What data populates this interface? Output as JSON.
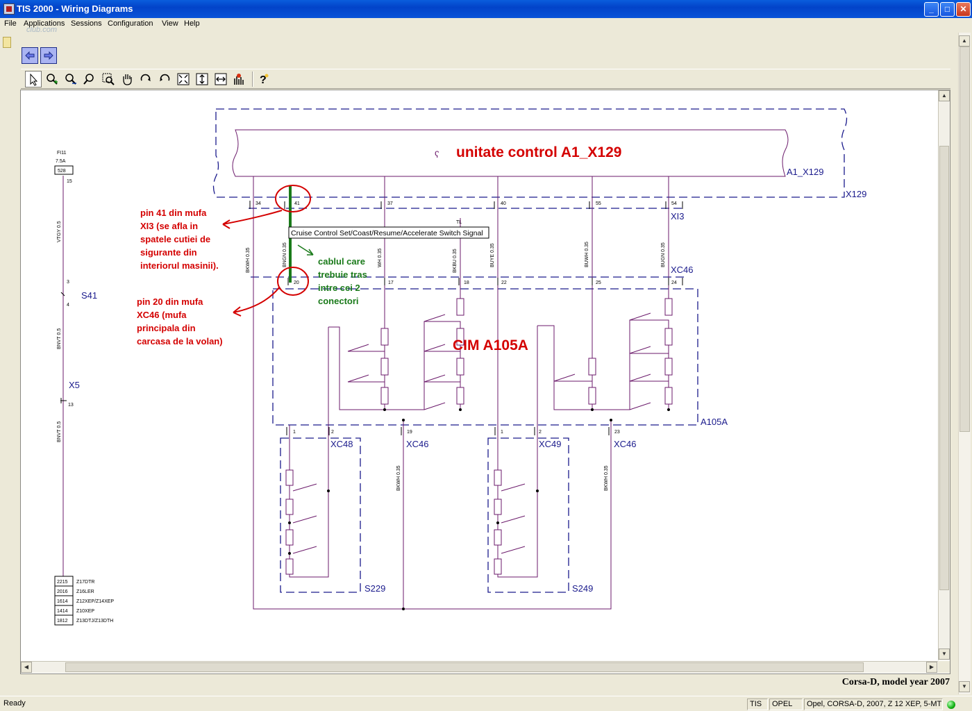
{
  "window": {
    "title": "TIS 2000 - Wiring Diagrams",
    "watermark": "club.com"
  },
  "menu": [
    "File",
    "Applications",
    "Sessions",
    "Configuration",
    "View",
    "Help"
  ],
  "toolbar": {
    "tools": [
      "pointer-icon",
      "zoom-in-icon",
      "zoom-out-icon",
      "zoom-icon",
      "zoom-window-icon",
      "pan-hand-icon",
      "rotate-cw-icon",
      "rotate-ccw-icon",
      "fit-page-icon",
      "fit-height-icon",
      "fit-width-icon",
      "signal-trace-icon",
      "help-icon"
    ]
  },
  "diagram": {
    "control_unit_label": "unitate control A1_X129",
    "a1_x129": "A1_X129",
    "x129": "X129",
    "xi3": "XI3",
    "xc46": "XC46",
    "a105a": "A105A",
    "cim": "CIM  A105A",
    "xc48": "XC48",
    "xc49": "XC49",
    "s229": "S229",
    "s249": "S249",
    "s41": "S41",
    "x5": "X5",
    "tl": "TL",
    "fuse": {
      "name": "FI11",
      "rating": "7.5A",
      "num": "528",
      "pin": "15"
    },
    "pins_top": [
      "34",
      "41",
      "37",
      "40",
      "55",
      "54"
    ],
    "pins_xc46": [
      "20",
      "17",
      "18",
      "22",
      "25",
      "24"
    ],
    "pins_bottom": [
      "1",
      "2",
      "19",
      "1",
      "2",
      "23"
    ],
    "left_pins": {
      "s41_top": "3",
      "s41_bot": "4",
      "x5": "13"
    },
    "wires": {
      "bkwh_a": "BKWH 0.35",
      "bngn": "BNGN 0.35",
      "whbu": "WH 0.35",
      "bkbu": "BKBU 0.35",
      "buye": "BUYE 0.35",
      "buwh": "BUWH 0.35",
      "bugn": "BUGN 0.35",
      "vtgy": "VTGY 0.5",
      "bnvt_a": "BNVT 0.5",
      "bnvt_b": "BNVT 0.5",
      "bkwh_b": "BKWH 0.35",
      "bkwh_c": "BKWH 0.35"
    },
    "signal_label": "Cruise Control Set/Coast/Resume/Accelerate Switch Signal",
    "annotations": {
      "pin41": [
        "pin 41 din mufa",
        "XI3 (se afla in",
        "spatele cutiei de",
        "sigurante din",
        "interiorul masinii)."
      ],
      "pin20": [
        "pin 20 din mufa",
        "XC46 (mufa",
        "principala din",
        "carcasa de la volan)"
      ],
      "cable": [
        "cablul care",
        "trebuie tras",
        "intre cei 2",
        "conectori"
      ]
    },
    "engine_table": [
      {
        "code": "2215",
        "engine": "Z17DTR"
      },
      {
        "code": "2016",
        "engine": "Z16LER"
      },
      {
        "code": "1614",
        "engine": "Z12XEP/Z14XEP"
      },
      {
        "code": "1414",
        "engine": "Z10XEP"
      },
      {
        "code": "1812",
        "engine": "Z13DTJ/Z13DTH"
      }
    ]
  },
  "caption": "Corsa-D, model year 2007",
  "status": {
    "left": "Ready",
    "app": "TIS",
    "brand": "OPEL",
    "vehicle": "Opel, CORSA-D, 2007, Z 12 XEP, 5-MT"
  },
  "colors": {
    "title_bar": "#0a5ddd",
    "wire": "#6b1a6b",
    "annotation_red": "#d40000",
    "annotation_green": "#1a7a1a",
    "dashed_blue": "#1a1a8c"
  }
}
